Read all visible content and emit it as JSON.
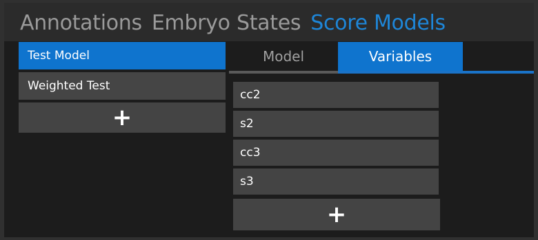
{
  "top_tabs": [
    {
      "label": "Annotations",
      "active": false
    },
    {
      "label": "Embryo States",
      "active": false
    },
    {
      "label": "Score Models",
      "active": true
    }
  ],
  "models": {
    "items": [
      {
        "label": "Test Model",
        "selected": true
      },
      {
        "label": "Weighted Test",
        "selected": false
      }
    ],
    "add_label": "+"
  },
  "detail_tabs": [
    {
      "label": "Model",
      "active": false
    },
    {
      "label": "Variables",
      "active": true
    }
  ],
  "variables": {
    "items": [
      "cc2",
      "s2",
      "cc3",
      "s3"
    ],
    "add_label": "+"
  },
  "colors": {
    "accent": "#0f74ce",
    "active_text": "#1e86d8",
    "panel": "#444444",
    "background": "#1c1c1c"
  }
}
